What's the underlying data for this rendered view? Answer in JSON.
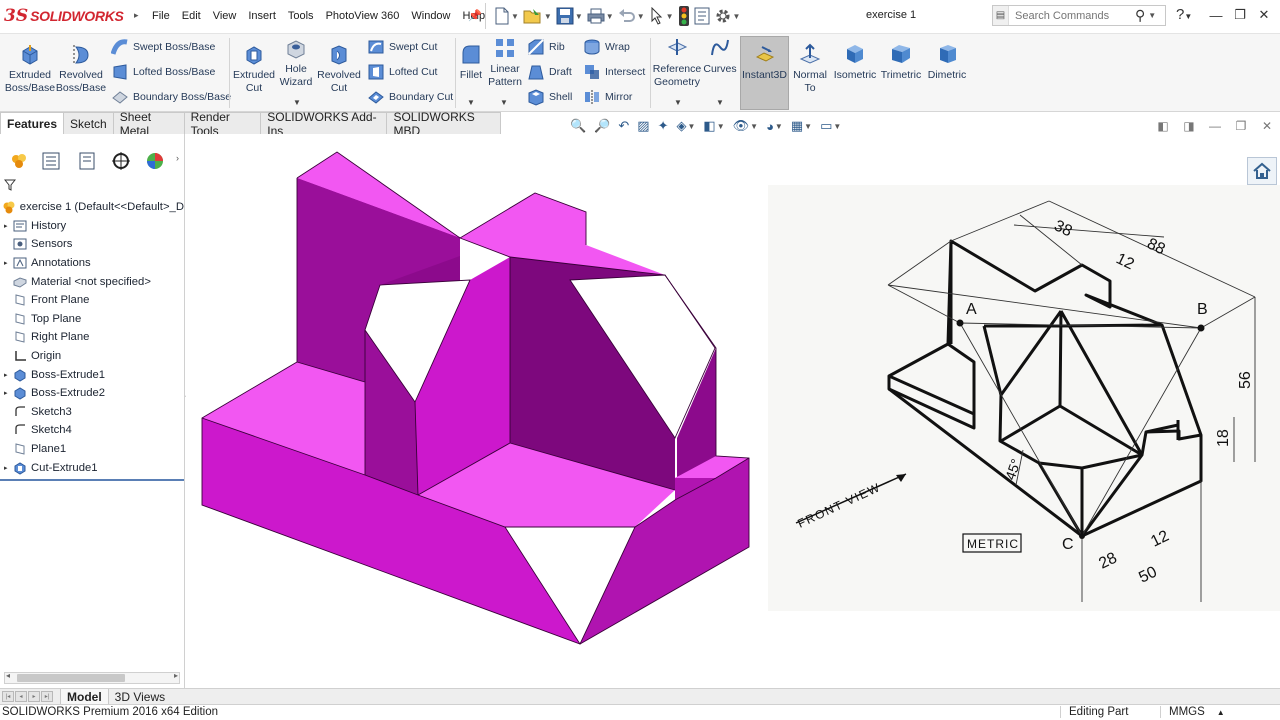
{
  "app": {
    "logo_prefix": "3S",
    "logo_brand": "SOLIDWORKS",
    "document_title": "exercise 1"
  },
  "menu": [
    "File",
    "Edit",
    "View",
    "Insert",
    "Tools",
    "PhotoView 360",
    "Window",
    "Help"
  ],
  "search": {
    "placeholder": "Search Commands"
  },
  "help_label": "?",
  "ribbon": {
    "extruded_boss": "Extruded Boss/Base",
    "revolved_boss": "Revolved Boss/Base",
    "swept_boss": "Swept Boss/Base",
    "lofted_boss": "Lofted Boss/Base",
    "boundary_boss": "Boundary Boss/Base",
    "extruded_cut": "Extruded Cut",
    "hole_wizard": "Hole Wizard",
    "revolved_cut": "Revolved Cut",
    "swept_cut": "Swept Cut",
    "lofted_cut": "Lofted Cut",
    "boundary_cut": "Boundary Cut",
    "fillet": "Fillet",
    "linear_pattern": "Linear Pattern",
    "rib": "Rib",
    "draft": "Draft",
    "shell": "Shell",
    "wrap": "Wrap",
    "intersect": "Intersect",
    "mirror": "Mirror",
    "reference_geometry": "Reference Geometry",
    "curves": "Curves",
    "instant3d": "Instant3D",
    "normal_to": "Normal To",
    "isometric": "Isometric",
    "trimetric": "Trimetric",
    "dimetric": "Dimetric"
  },
  "tabs": [
    "Features",
    "Sketch",
    "Sheet Metal",
    "Render Tools",
    "SOLIDWORKS Add-Ins",
    "SOLIDWORKS MBD"
  ],
  "tree": [
    {
      "label": "exercise 1  (Default<<Default>_D",
      "icon": "part-icon",
      "expandable": false,
      "indent": 0
    },
    {
      "label": "History",
      "icon": "history-icon",
      "expandable": true,
      "indent": 1
    },
    {
      "label": "Sensors",
      "icon": "sensors-icon",
      "expandable": false,
      "indent": 1
    },
    {
      "label": "Annotations",
      "icon": "annotations-icon",
      "expandable": true,
      "indent": 1
    },
    {
      "label": "Material <not specified>",
      "icon": "material-icon",
      "expandable": false,
      "indent": 1
    },
    {
      "label": "Front Plane",
      "icon": "plane-icon",
      "expandable": false,
      "indent": 1
    },
    {
      "label": "Top Plane",
      "icon": "plane-icon",
      "expandable": false,
      "indent": 1
    },
    {
      "label": "Right Plane",
      "icon": "plane-icon",
      "expandable": false,
      "indent": 1
    },
    {
      "label": "Origin",
      "icon": "origin-icon",
      "expandable": false,
      "indent": 1
    },
    {
      "label": "Boss-Extrude1",
      "icon": "extrude-feature-icon",
      "expandable": true,
      "indent": 1
    },
    {
      "label": "Boss-Extrude2",
      "icon": "extrude-feature-icon",
      "expandable": true,
      "indent": 1
    },
    {
      "label": "Sketch3",
      "icon": "sketch-icon",
      "expandable": false,
      "indent": 1
    },
    {
      "label": "Sketch4",
      "icon": "sketch-icon",
      "expandable": false,
      "indent": 1
    },
    {
      "label": "Plane1",
      "icon": "plane-icon",
      "expandable": false,
      "indent": 1
    },
    {
      "label": "Cut-Extrude1",
      "icon": "cut-feature-icon",
      "expandable": true,
      "indent": 1
    }
  ],
  "drawing": {
    "dims": {
      "d88": "88",
      "d38": "38",
      "d12_top": "12",
      "d56": "56",
      "d18": "18",
      "d45": "45°",
      "d28": "28",
      "d12_bottom": "12",
      "d50": "50"
    },
    "point_a": "A",
    "point_b": "B",
    "point_c": "C",
    "front_view": "FRONT VIEW",
    "metric": "METRIC"
  },
  "bottom_tabs": [
    "Model",
    "3D Views"
  ],
  "status": {
    "edition": "SOLIDWORKS Premium 2016 x64 Edition",
    "mode": "Editing Part",
    "units": "MMGS"
  },
  "colors": {
    "part_top": "#f257f2",
    "part_front": "#cc18cc",
    "part_side": "#8c0a8c",
    "brand_red": "#d22630"
  }
}
